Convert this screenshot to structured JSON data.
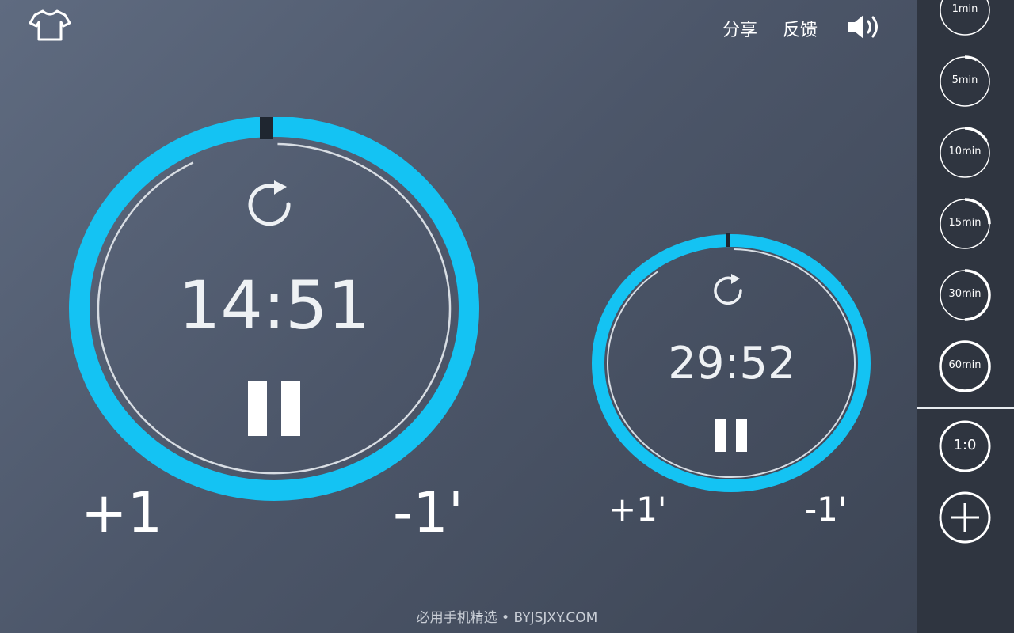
{
  "header": {
    "shirt_icon": "tshirt-icon",
    "share_label": "分享",
    "feedback_label": "反馈",
    "volume_icon": "speaker-icon"
  },
  "timers": [
    {
      "time": "14:51",
      "progress": 0.99,
      "reset_icon": "refresh-icon",
      "pause_icon": "pause-icon",
      "plus_label": "+1",
      "minus_label": "-1'"
    },
    {
      "time": "29:52",
      "progress": 0.995,
      "reset_icon": "refresh-icon",
      "pause_icon": "pause-icon",
      "plus_label": "+1'",
      "minus_label": "-1'"
    }
  ],
  "sidebar": {
    "presets": [
      {
        "label": "1min",
        "fill": 0.05
      },
      {
        "label": "5min",
        "fill": 0.08
      },
      {
        "label": "10min",
        "fill": 0.17
      },
      {
        "label": "15min",
        "fill": 0.25
      },
      {
        "label": "30min",
        "fill": 0.5
      },
      {
        "label": "60min",
        "fill": 1.0
      }
    ],
    "ratio_label": "1:0",
    "add_icon": "plus-icon"
  },
  "colors": {
    "accent": "#14c3f3",
    "sidebar_bg": "#2f3540",
    "gap": "#1f2630"
  },
  "footer": {
    "watermark": "必用手机精选 • BYJSJXY.COM"
  }
}
